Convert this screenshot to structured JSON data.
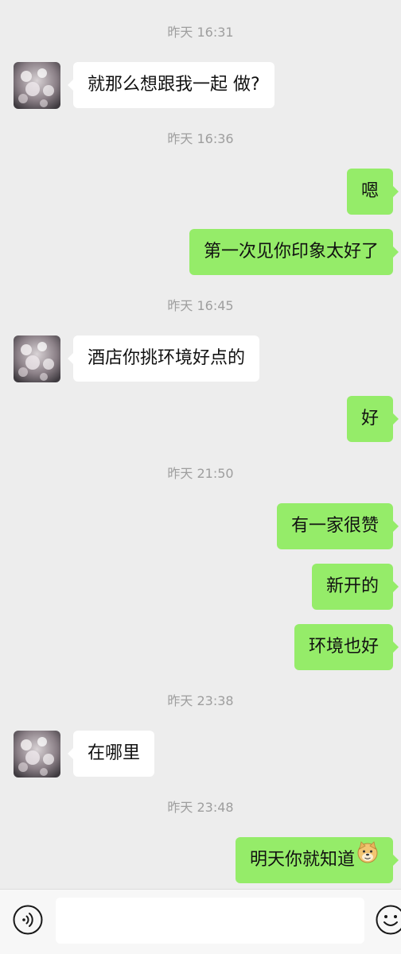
{
  "messages": [
    {
      "type": "timestamp",
      "text": "昨天 16:31"
    },
    {
      "type": "incoming",
      "text": "就那么想跟我一起 做?"
    },
    {
      "type": "timestamp",
      "text": "昨天 16:36"
    },
    {
      "type": "outgoing",
      "text": "嗯"
    },
    {
      "type": "outgoing",
      "text": "第一次见你印象太好了"
    },
    {
      "type": "timestamp",
      "text": "昨天 16:45"
    },
    {
      "type": "incoming",
      "text": "酒店你挑环境好点的"
    },
    {
      "type": "outgoing",
      "text": "好"
    },
    {
      "type": "timestamp",
      "text": "昨天 21:50"
    },
    {
      "type": "outgoing",
      "text": "有一家很赞"
    },
    {
      "type": "outgoing",
      "text": "新开的"
    },
    {
      "type": "outgoing",
      "text": "环境也好"
    },
    {
      "type": "timestamp",
      "text": "昨天 23:38"
    },
    {
      "type": "incoming",
      "text": "在哪里"
    },
    {
      "type": "timestamp",
      "text": "昨天 23:48"
    },
    {
      "type": "outgoing",
      "text": "明天你就知道",
      "emoji": "doge-emoji-icon"
    }
  ],
  "input": {
    "value": "",
    "placeholder": ""
  },
  "icons": {
    "voice": "voice-icon",
    "emoji": "smiley-icon",
    "avatar": "contact-avatar"
  },
  "colors": {
    "background": "#ededed",
    "outgoing_bubble": "#95ec69",
    "incoming_bubble": "#ffffff",
    "timestamp_text": "#9e9e9e"
  }
}
